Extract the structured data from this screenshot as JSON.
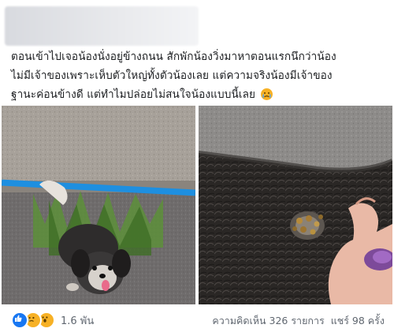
{
  "post": {
    "text_lines": [
      "ตอนเข้าไปเจอน้องนั่งอยู่ข้างถนน สักพักน้องวิ่งมาหาตอนแรกนึกว่าน้อง",
      "ไม่มีเจ้าของเพราะเห็บตัวใหญ่ทั้งตัวน้องเลย แต่ความจริงน้องมีเจ้าของ",
      "ฐานะค่อนข้างดี แต่ทำไมปล่อยไม่สนใจน้องแบบนี้เลย"
    ],
    "emoji": "crying-face"
  },
  "photos": [
    {
      "icon": "dog-on-street-photo"
    },
    {
      "icon": "ticks-on-fur-photo"
    }
  ],
  "footer": {
    "reaction_icons": [
      "like-icon",
      "sad-icon",
      "wow-icon"
    ],
    "reaction_count": "1.6 พัน",
    "comments": "ความคิดเห็น 326 รายการ",
    "shares": "แชร์ 98 ครั้ง"
  }
}
